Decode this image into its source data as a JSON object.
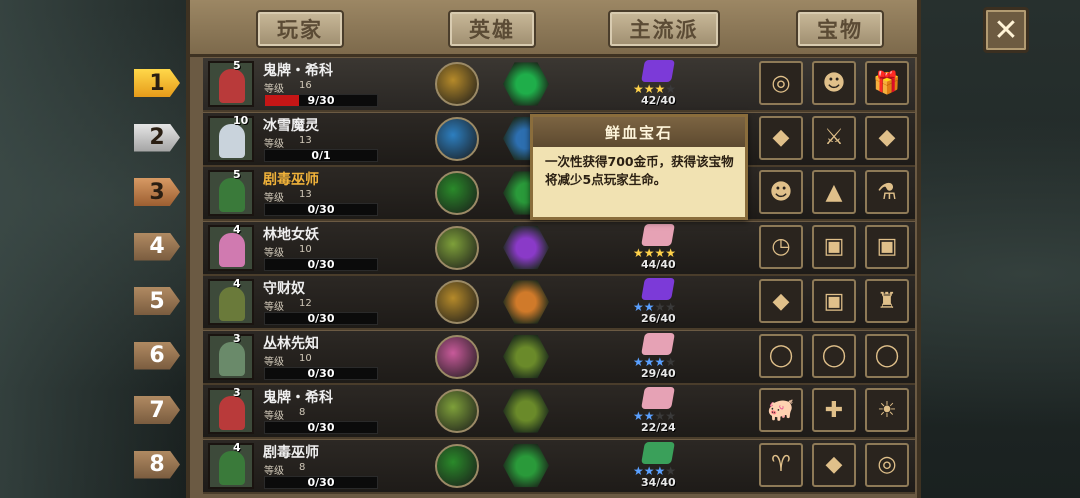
{
  "tabs": [
    "玩家",
    "英雄",
    "主流派",
    "宝物"
  ],
  "close_icon": "close-icon",
  "tooltip": {
    "title": "鲜血宝石",
    "body": "一次性获得700金币，获得该宝物将减少5点玩家生命。"
  },
  "level_label": "等级",
  "rows": [
    {
      "rank": "1",
      "badge": "5",
      "name": "鬼牌・希科",
      "level": "16",
      "hp": "9/30",
      "hp_pct": 0.3,
      "score": "42/40",
      "stars_gold": 3,
      "stars_blue": 0,
      "book_color": "#7c3ad8",
      "hero": "#b58a2a",
      "skill": "#1fae4a",
      "portrait": "#b93a3a",
      "treasures": [
        "compass-icon",
        "mask-icon",
        "gift-box-icon"
      ],
      "treasure_glyphs": [
        "◎",
        "☻",
        "🎁"
      ]
    },
    {
      "rank": "2",
      "badge": "10",
      "name": "冰雪魔灵",
      "level": "13",
      "hp": "0/1",
      "hp_pct": 0,
      "score": "",
      "stars_gold": 0,
      "stars_blue": 0,
      "book_color": "",
      "hero": "#2d7fc0",
      "skill": "#2d6fb0",
      "portrait": "#c9d3dc",
      "treasures": [
        "blood-gem-icon",
        "dagger-icon",
        "red-gem-icon"
      ],
      "treasure_glyphs": [
        "◆",
        "⚔",
        "◆"
      ]
    },
    {
      "rank": "3",
      "badge": "5",
      "name": "剧毒巫师",
      "level": "13",
      "hp": "0/30",
      "hp_pct": 0,
      "score": "",
      "stars_gold": 0,
      "stars_blue": 0,
      "book_color": "",
      "hero": "#2a8a2a",
      "skill": "#2a9a3a",
      "portrait": "#3a7a3a",
      "treasures": [
        "mask-icon",
        "hat-icon",
        "potion-icon"
      ],
      "treasure_glyphs": [
        "☻",
        "▲",
        "⚗"
      ]
    },
    {
      "rank": "4",
      "badge": "4",
      "name": "林地女妖",
      "level": "10",
      "hp": "0/30",
      "hp_pct": 0,
      "score": "44/40",
      "stars_gold": 4,
      "stars_blue": 0,
      "book_color": "#e6a2b5",
      "hero": "#7ea03a",
      "skill": "#8a3ac8",
      "portrait": "#d07ab0",
      "treasures": [
        "pocket-watch-icon",
        "chest-icon",
        "chest-icon"
      ],
      "treasure_glyphs": [
        "◷",
        "▣",
        "▣"
      ]
    },
    {
      "rank": "5",
      "badge": "4",
      "name": "守财奴",
      "level": "12",
      "hp": "0/30",
      "hp_pct": 0,
      "score": "26/40",
      "stars_gold": 0,
      "stars_blue": 2,
      "book_color": "#7c3ad8",
      "hero": "#b58a2a",
      "skill": "#d07a2a",
      "portrait": "#6a7a3a",
      "treasures": [
        "red-gem-icon",
        "chest-icon",
        "statue-icon"
      ],
      "treasure_glyphs": [
        "◆",
        "▣",
        "♜"
      ]
    },
    {
      "rank": "6",
      "badge": "3",
      "name": "丛林先知",
      "level": "10",
      "hp": "0/30",
      "hp_pct": 0,
      "score": "29/40",
      "stars_gold": 0,
      "stars_blue": 3,
      "book_color": "#e6a2b5",
      "hero": "#c85a9a",
      "skill": "#6a8a2a",
      "portrait": "#6a8a6a",
      "treasures": [
        "ring-icon",
        "ring-icon",
        "ring-icon"
      ],
      "treasure_glyphs": [
        "◯",
        "◯",
        "◯"
      ]
    },
    {
      "rank": "7",
      "badge": "3",
      "name": "鬼牌・希科",
      "level": "8",
      "hp": "0/30",
      "hp_pct": 0,
      "score": "22/24",
      "stars_gold": 0,
      "stars_blue": 2,
      "book_color": "#e6a2b5",
      "hero": "#7ea03a",
      "skill": "#6a8a2a",
      "portrait": "#b93a3a",
      "treasures": [
        "piggy-bank-icon",
        "medkit-icon",
        "lantern-icon"
      ],
      "treasure_glyphs": [
        "🐖",
        "✚",
        "☀"
      ]
    },
    {
      "rank": "8",
      "badge": "4",
      "name": "剧毒巫师",
      "level": "8",
      "hp": "0/30",
      "hp_pct": 0,
      "score": "34/40",
      "stars_gold": 0,
      "stars_blue": 3,
      "book_color": "#3aa05a",
      "hero": "#2a8a2a",
      "skill": "#2a9a3a",
      "portrait": "#3a7a3a",
      "treasures": [
        "horn-icon",
        "red-gem-icon",
        "whistle-icon"
      ],
      "treasure_glyphs": [
        "♈",
        "◆",
        "◎"
      ]
    }
  ]
}
